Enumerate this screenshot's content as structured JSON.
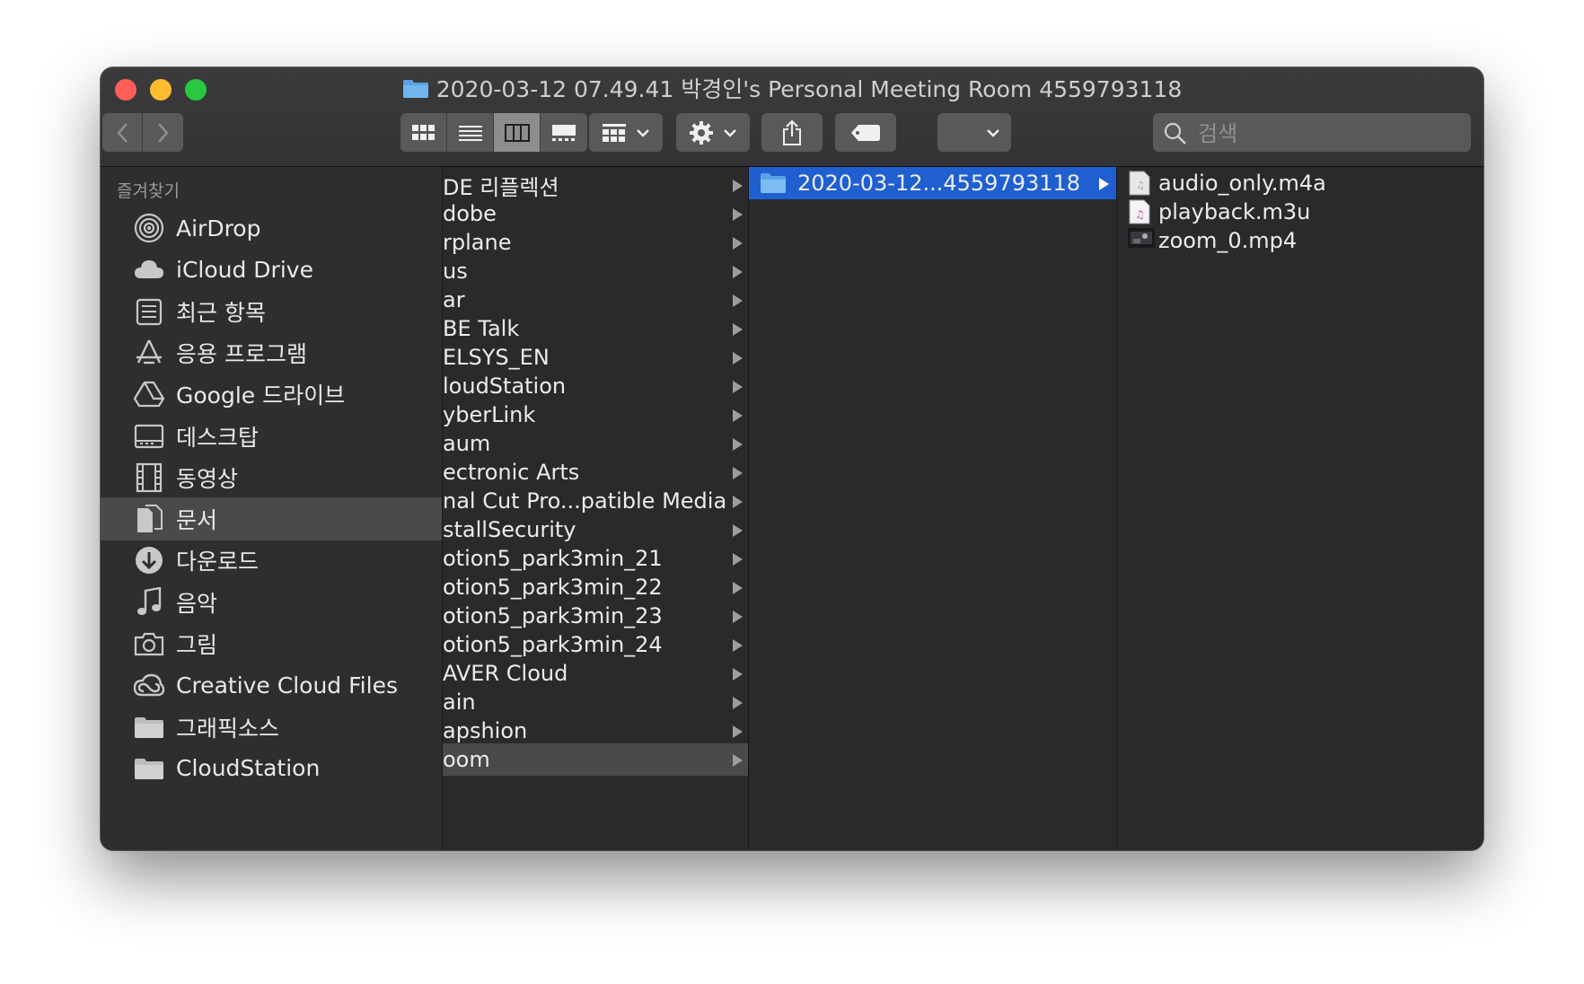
{
  "window": {
    "title": "2020-03-12 07.49.41 박경인's Personal Meeting Room 4559793118"
  },
  "toolbar": {
    "back_label": "‹",
    "forward_label": "›",
    "search_placeholder": "검색"
  },
  "sidebar": {
    "header": "즐겨찾기",
    "items": [
      {
        "label": "AirDrop",
        "icon": "airdrop-icon"
      },
      {
        "label": "iCloud Drive",
        "icon": "cloud-icon"
      },
      {
        "label": "최근 항목",
        "icon": "recents-icon"
      },
      {
        "label": "응용 프로그램",
        "icon": "applications-icon"
      },
      {
        "label": "Google 드라이브",
        "icon": "google-drive-icon"
      },
      {
        "label": "데스크탑",
        "icon": "desktop-icon"
      },
      {
        "label": "동영상",
        "icon": "movies-icon"
      },
      {
        "label": "문서",
        "icon": "documents-icon",
        "selected": true
      },
      {
        "label": "다운로드",
        "icon": "downloads-icon"
      },
      {
        "label": "음악",
        "icon": "music-icon"
      },
      {
        "label": "그림",
        "icon": "pictures-icon"
      },
      {
        "label": "Creative Cloud Files",
        "icon": "creative-cloud-icon"
      },
      {
        "label": "그래픽소스",
        "icon": "folder-icon"
      },
      {
        "label": "CloudStation",
        "icon": "folder-icon"
      }
    ]
  },
  "column1": {
    "items": [
      "DE 리플렉션",
      "dobe",
      "rplane",
      "us",
      "ar",
      "BE Talk",
      "ELSYS_EN",
      "loudStation",
      "yberLink",
      "aum",
      "ectronic Arts",
      "nal Cut Pro...patible Media",
      "stallSecurity",
      "otion5_park3min_21",
      "otion5_park3min_22",
      "otion5_park3min_23",
      "otion5_park3min_24",
      "AVER Cloud",
      "ain",
      "apshion",
      "oom"
    ],
    "selected_index": 20
  },
  "column2": {
    "items": [
      "2020-03-12...4559793118"
    ],
    "selected_index": 0
  },
  "column3": {
    "items": [
      {
        "name": "audio_only.m4a",
        "icon": "audio-file-icon"
      },
      {
        "name": "playback.m3u",
        "icon": "playlist-file-icon"
      },
      {
        "name": "zoom_0.mp4",
        "icon": "video-thumbnail-icon"
      }
    ]
  },
  "colors": {
    "accent": "#1f5fd0",
    "window_bg": "#2b2b2d",
    "close": "#fe5f57",
    "minimize": "#febc2e",
    "zoom": "#28c840",
    "folder": "#5aa4e6"
  }
}
